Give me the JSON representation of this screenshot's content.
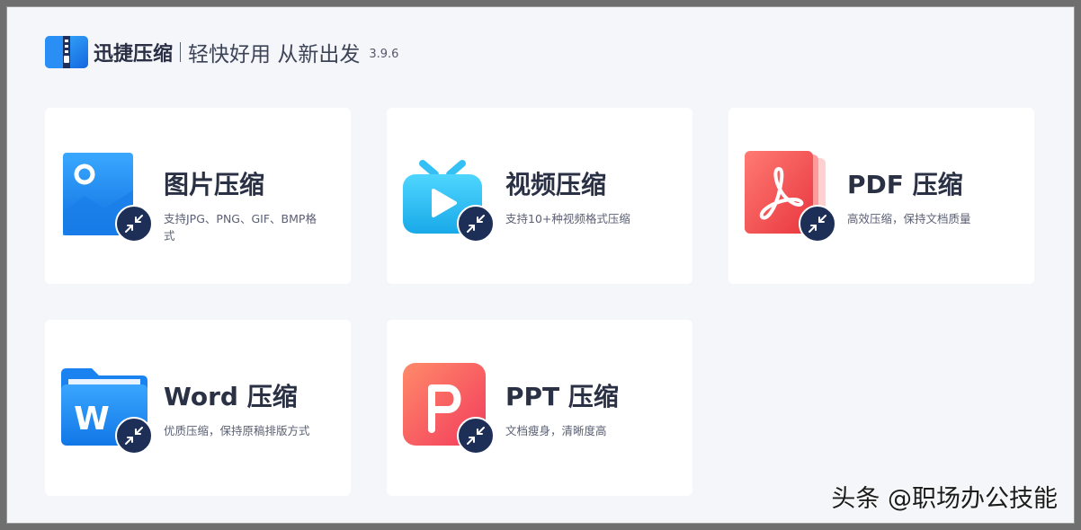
{
  "app": {
    "name": "迅捷压缩",
    "slogan": "轻快好用 从新出发",
    "version": "3.9.6"
  },
  "cards": [
    {
      "title": "图片压缩",
      "desc": "支持JPG、PNG、GIF、BMP格式",
      "icon": "image-icon",
      "color": "#1a8ff0"
    },
    {
      "title": "视频压缩",
      "desc": "支持10+种视频格式压缩",
      "icon": "tv-icon",
      "color": "#2ec5ef"
    },
    {
      "title": "PDF 压缩",
      "desc": "高效压缩，保持文档质量",
      "icon": "pdf-icon",
      "color": "#f2585b"
    },
    {
      "title": "Word 压缩",
      "desc": "优质压缩，保持原稿排版方式",
      "icon": "word-icon",
      "color": "#1d8cf0"
    },
    {
      "title": "PPT 压缩",
      "desc": "文档瘦身，清晰度高",
      "icon": "ppt-icon",
      "color": "#f64a5e"
    }
  ],
  "watermark": "头条 @职场办公技能"
}
